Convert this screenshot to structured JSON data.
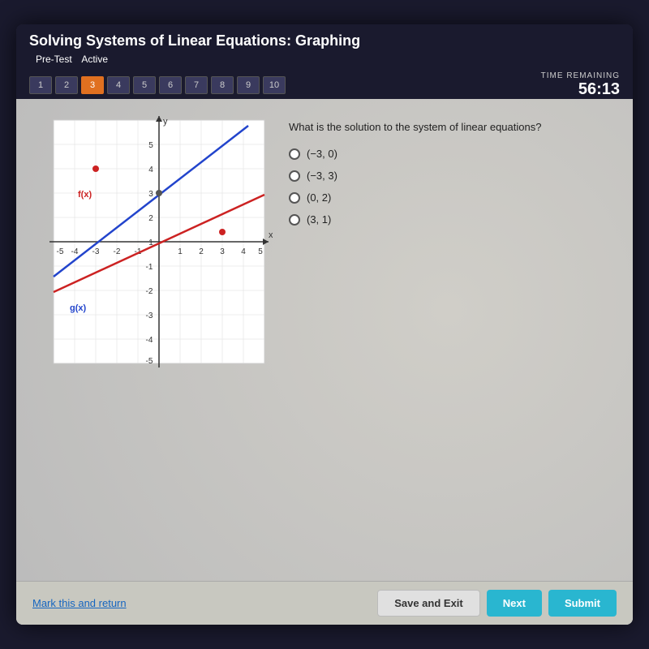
{
  "header": {
    "title": "Solving Systems of Linear Equations: Graphing",
    "test_type": "Pre-Test",
    "status": "Active",
    "time_label": "TIME REMAINING",
    "time_value": "56:13"
  },
  "tabs": {
    "items": [
      1,
      2,
      3,
      4,
      5,
      6,
      7,
      8,
      9,
      10
    ],
    "active": 3
  },
  "question": {
    "text": "What is the solution to the system of linear equations?",
    "answers": [
      {
        "label": "(−3, 0)"
      },
      {
        "label": "(−3, 3)"
      },
      {
        "label": "(0, 2)"
      },
      {
        "label": "(3, 1)"
      }
    ]
  },
  "graph": {
    "fx_label": "f(x)",
    "gx_label": "g(x)"
  },
  "buttons": {
    "save": "Save and Exit",
    "next": "Next",
    "submit": "Submit",
    "mark": "Mark this and return"
  }
}
